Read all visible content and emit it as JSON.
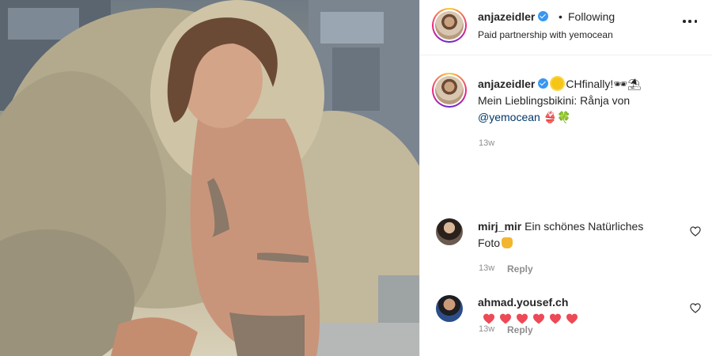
{
  "post": {
    "author": "anjazeidler",
    "follow_separator": "•",
    "follow_status": "Following",
    "partnership": "Paid partnership with yemocean"
  },
  "caption": {
    "user": "anjazeidler",
    "line1": "CHfinally!🕶⛱",
    "line2": "Mein Lieblingsbikini: Rånja von",
    "mention": "@yemocean",
    "emojis": "👙🍀",
    "time": "13w"
  },
  "comments": [
    {
      "user": "mirj_mir",
      "text": "Ein schönes Natürliches Foto",
      "time": "13w",
      "reply": "Reply"
    },
    {
      "user": "ahmad.yousef.ch",
      "text": "",
      "hearts": 6,
      "time": "13w",
      "reply": "Reply"
    }
  ],
  "colors": {
    "verified": "#3897f0",
    "mention": "#00376b",
    "heart": "#ed4956",
    "muted": "#8e8e8e"
  },
  "icons": {
    "more": "more-horizontal-icon",
    "verified": "verified-badge-icon",
    "like": "heart-outline-icon"
  }
}
